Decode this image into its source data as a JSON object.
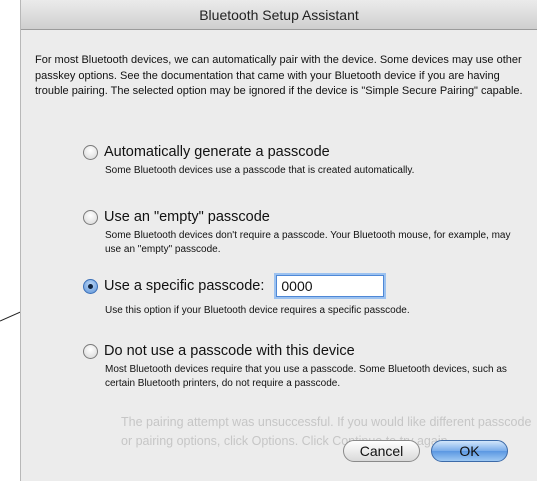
{
  "window": {
    "title": "Bluetooth Setup Assistant"
  },
  "intro": "For most Bluetooth devices, we can automatically pair with the device. Some devices may use other passkey options. See the documentation that came with your Bluetooth device if you are having trouble pairing. The selected option may be ignored if the device is \"Simple Secure Pairing\" capable.",
  "options": [
    {
      "label": "Automatically generate a passcode",
      "description": "Some Bluetooth devices use a passcode that is created automatically.",
      "selected": false
    },
    {
      "label": "Use an \"empty\" passcode",
      "description": "Some Bluetooth devices don't require a passcode. Your Bluetooth mouse, for example, may use an \"empty\" passcode.",
      "selected": false
    },
    {
      "label": "Use a specific passcode:",
      "description": "Use this option if your Bluetooth device requires a specific passcode.",
      "selected": true
    },
    {
      "label": "Do not use a passcode with this device",
      "description": "Most Bluetooth devices require that you use a passcode. Some Bluetooth devices, such as certain Bluetooth printers, do not require a passcode.",
      "selected": false
    }
  ],
  "passcode_value": "0000",
  "background_text": "The pairing attempt was unsuccessful. If you would like different passcode or pairing options, click Options. Click Continue to try again.",
  "buttons": {
    "cancel": "Cancel",
    "ok": "OK"
  }
}
